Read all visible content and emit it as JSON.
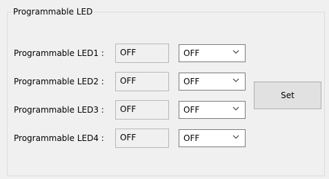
{
  "group": {
    "title": "Programmable LED"
  },
  "leds": [
    {
      "label": "Programmable LED1 :",
      "state": "OFF",
      "selected": "OFF"
    },
    {
      "label": "Programmable LED2 :",
      "state": "OFF",
      "selected": "OFF"
    },
    {
      "label": "Programmable LED3 :",
      "state": "OFF",
      "selected": "OFF"
    },
    {
      "label": "Programmable LED4 :",
      "state": "OFF",
      "selected": "OFF"
    }
  ],
  "set_button": {
    "label": "Set"
  },
  "icons": {
    "dropdown": "chevron-down-icon"
  },
  "colors": {
    "panel_background": "#f0f0f0",
    "group_border": "#dcdcdc",
    "state_box_border": "#b7b7b7",
    "select_border": "#7a7a7a",
    "button_background": "#e1e1e1",
    "button_border": "#adadad"
  }
}
